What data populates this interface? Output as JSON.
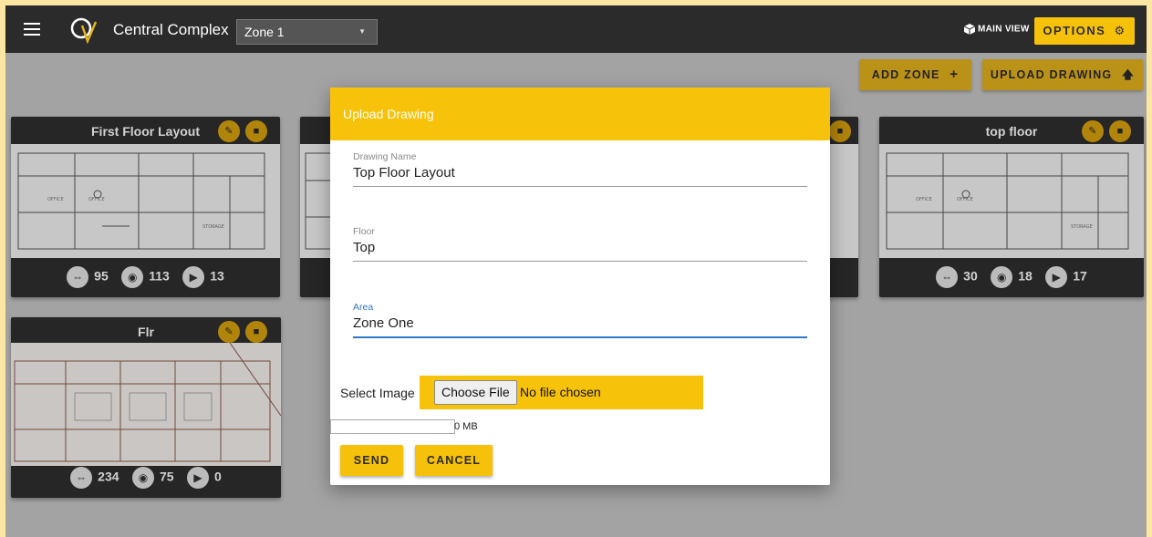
{
  "topbar": {
    "app_title": "Central Complex",
    "zone_selected": "Zone 1",
    "main_view_label": "MAIN VIEW",
    "options_label": "OPTIONS"
  },
  "actions": {
    "add_zone_label": "ADD ZONE",
    "upload_drawing_label": "UPLOAD DRAWING"
  },
  "cards": [
    {
      "title": "First Floor Layout",
      "stats": {
        "view360": "95",
        "photos": "113",
        "videos": "13"
      }
    },
    {
      "title": "",
      "stats": {
        "view360": "",
        "photos": "",
        "videos": ""
      }
    },
    {
      "title": "top floor",
      "stats": {
        "view360": "30",
        "photos": "18",
        "videos": "17"
      }
    },
    {
      "title": "Flr",
      "stats": {
        "view360": "234",
        "photos": "75",
        "videos": "0"
      }
    }
  ],
  "dialog": {
    "title": "Upload Drawing",
    "drawing_name_label": "Drawing Name",
    "drawing_name_value": "Top Floor Layout",
    "floor_label": "Floor",
    "floor_value": "Top",
    "area_label": "Area",
    "area_value": "Zone One",
    "select_image_label": "Select Image",
    "choose_file_label": "Choose File",
    "no_file_text": "No file chosen",
    "upload_progress": 0,
    "size_text": "0 MB",
    "send_label": "SEND",
    "cancel_label": "CANCEL"
  },
  "colors": {
    "accent": "#f7c20a",
    "topbar": "#2b2b2b",
    "background": "#c7c7c7",
    "focus": "#2f78c6"
  },
  "icons": [
    "menu-icon",
    "logo-icon",
    "cube-icon",
    "gear-icon",
    "plus-icon",
    "upload-arrow-icon",
    "edit-icon",
    "trash-icon",
    "360-view-icon",
    "camera-icon",
    "play-icon"
  ]
}
